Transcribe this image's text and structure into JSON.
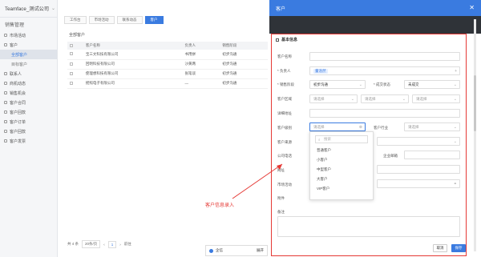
{
  "app": {
    "title": "Teamface_测试公司"
  },
  "sidebar": {
    "section_title": "销售管理",
    "items": [
      {
        "label": "市场活动",
        "sub": false,
        "active": false
      },
      {
        "label": "客户",
        "sub": false,
        "active": false
      },
      {
        "label": "全部客户",
        "sub": true,
        "active": true
      },
      {
        "label": "目标客户",
        "sub": true,
        "active": false
      },
      {
        "label": "联系人",
        "sub": false,
        "active": false
      },
      {
        "label": "商机动态",
        "sub": false,
        "active": false
      },
      {
        "label": "销售机会",
        "sub": false,
        "active": false
      },
      {
        "label": "客户合同",
        "sub": false,
        "active": false
      },
      {
        "label": "客户回款",
        "sub": false,
        "active": false
      },
      {
        "label": "客户订单",
        "sub": false,
        "active": false
      },
      {
        "label": "客户回款",
        "sub": false,
        "active": false
      },
      {
        "label": "客户发票",
        "sub": false,
        "active": false
      }
    ]
  },
  "tabs": [
    "工作台",
    "市场活动",
    "联系动态",
    "客户"
  ],
  "main": {
    "breadcrumb": "全部客户",
    "columns": [
      "客户名称",
      "负责人",
      "销售阶段"
    ],
    "rows": [
      [
        "宝三文科技有限公司",
        "书用拼",
        "初步沟通"
      ],
      [
        "回明科技有限公司",
        "沙黄两",
        "初步沟通"
      ],
      [
        "使理想科技有限公司",
        "张笔谈",
        "初步沟通"
      ],
      [
        "摇照电子有限公司",
        "—",
        "初步沟通"
      ]
    ],
    "pager": {
      "total": "共 4 条",
      "page_size": "20条/页",
      "page": "1",
      "goto": "前往"
    },
    "chat": {
      "label": "企信",
      "expand": "展开"
    }
  },
  "modal": {
    "title": "客户",
    "close_icon": "close-icon",
    "section": "基本信息",
    "fields": {
      "name_label": "客户名称",
      "owner_label": "* 负责人",
      "owner_chip": "董浩然",
      "stage_label": "* 销售阶段",
      "stage_value": "初步沟通",
      "status_label": "* 成交状态",
      "status_value": "未成交",
      "region_label": "客户区域",
      "select_placeholder": "请选择",
      "address_label": "详细地址",
      "level_label": "客户级别",
      "industry_label": "客户行业",
      "source_label": "客户来源",
      "phone_label": "公司电话",
      "email_label": "企业邮箱",
      "website_label": "网址",
      "activity_label": "市场活动",
      "attach_label": "附件",
      "remark_label": "备注"
    },
    "dropdown": {
      "search_placeholder": "搜索",
      "options": [
        "普通客户",
        "小客户",
        "中型客户",
        "大客户",
        "VIP客户"
      ]
    },
    "buttons": {
      "cancel": "取消",
      "save": "保存"
    }
  },
  "annotation": "客户信息录入",
  "colors": {
    "accent": "#3a7be0",
    "highlight": "#e53935"
  }
}
